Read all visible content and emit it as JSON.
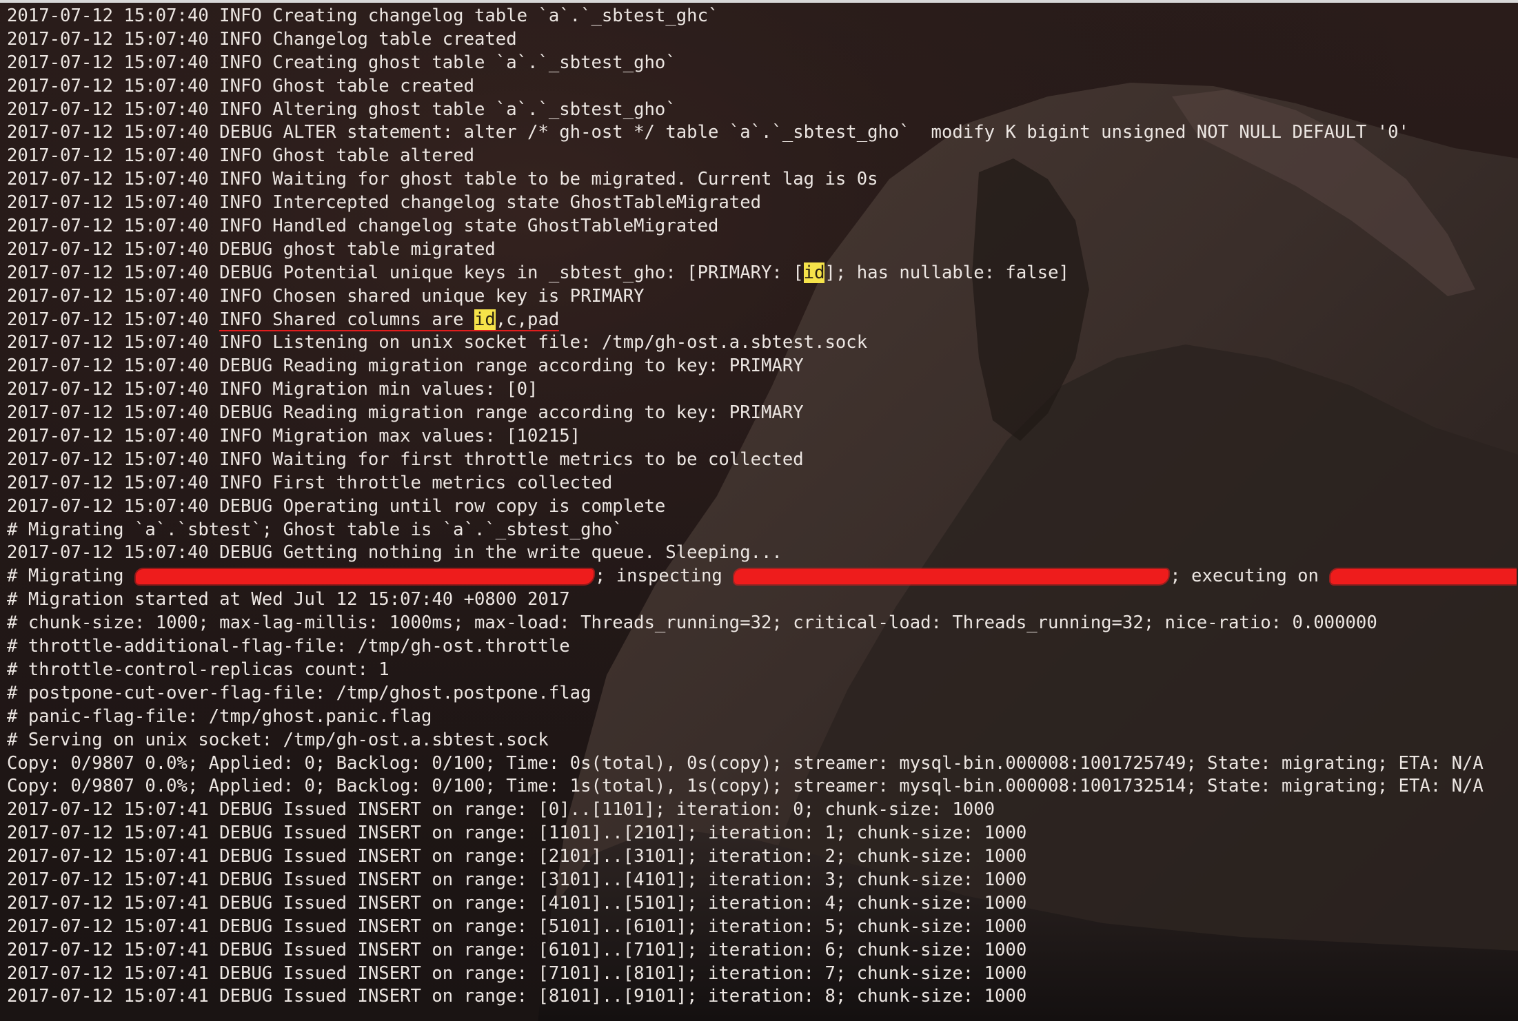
{
  "terminal": {
    "lines": [
      {
        "segments": [
          {
            "text": "2017-07-12 15:07:40 INFO Creating changelog table `a`.`_sbtest_ghc`"
          }
        ]
      },
      {
        "segments": [
          {
            "text": "2017-07-12 15:07:40 INFO Changelog table created"
          }
        ]
      },
      {
        "segments": [
          {
            "text": "2017-07-12 15:07:40 INFO Creating ghost table `a`.`_sbtest_gho`"
          }
        ]
      },
      {
        "segments": [
          {
            "text": "2017-07-12 15:07:40 INFO Ghost table created"
          }
        ]
      },
      {
        "segments": [
          {
            "text": "2017-07-12 15:07:40 INFO Altering ghost table `a`.`_sbtest_gho`"
          }
        ]
      },
      {
        "segments": [
          {
            "text": "2017-07-12 15:07:40 DEBUG ALTER statement: alter /* gh-ost */ table `a`.`_sbtest_gho`  modify K bigint unsigned NOT NULL DEFAULT '0'"
          }
        ]
      },
      {
        "segments": [
          {
            "text": "2017-07-12 15:07:40 INFO Ghost table altered"
          }
        ]
      },
      {
        "segments": [
          {
            "text": "2017-07-12 15:07:40 INFO Waiting for ghost table to be migrated. Current lag is 0s"
          }
        ]
      },
      {
        "segments": [
          {
            "text": "2017-07-12 15:07:40 INFO Intercepted changelog state GhostTableMigrated"
          }
        ]
      },
      {
        "segments": [
          {
            "text": "2017-07-12 15:07:40 INFO Handled changelog state GhostTableMigrated"
          }
        ]
      },
      {
        "segments": [
          {
            "text": "2017-07-12 15:07:40 DEBUG ghost table migrated"
          }
        ]
      },
      {
        "segments": [
          {
            "text": "2017-07-12 15:07:40 DEBUG Potential unique keys in _sbtest_gho: [PRIMARY: ["
          },
          {
            "text": "id",
            "style": "hl"
          },
          {
            "text": "]; has nullable: false]"
          }
        ]
      },
      {
        "segments": [
          {
            "text": "2017-07-12 15:07:40 INFO Chosen shared unique key is PRIMARY"
          }
        ]
      },
      {
        "segments": [
          {
            "text": "2017-07-12 15:07:40 "
          },
          {
            "text": "INFO Shared columns are ",
            "style": "underlined"
          },
          {
            "text": "id",
            "style": "hl underlined"
          },
          {
            "text": ",c,pad",
            "style": "underlined"
          }
        ]
      },
      {
        "segments": [
          {
            "text": "2017-07-12 15:07:40 INFO Listening on unix socket file: /tmp/gh-ost.a.sbtest.sock"
          }
        ]
      },
      {
        "segments": [
          {
            "text": "2017-07-12 15:07:40 DEBUG Reading migration range according to key: PRIMARY"
          }
        ]
      },
      {
        "segments": [
          {
            "text": "2017-07-12 15:07:40 INFO Migration min values: [0]"
          }
        ]
      },
      {
        "segments": [
          {
            "text": "2017-07-12 15:07:40 DEBUG Reading migration range according to key: PRIMARY"
          }
        ]
      },
      {
        "segments": [
          {
            "text": "2017-07-12 15:07:40 INFO Migration max values: [10215]"
          }
        ]
      },
      {
        "segments": [
          {
            "text": "2017-07-12 15:07:40 INFO Waiting for first throttle metrics to be collected"
          }
        ]
      },
      {
        "segments": [
          {
            "text": "2017-07-12 15:07:40 INFO First throttle metrics collected"
          }
        ]
      },
      {
        "segments": [
          {
            "text": "2017-07-12 15:07:40 DEBUG Operating until row copy is complete"
          }
        ]
      },
      {
        "segments": [
          {
            "text": "# Migrating `a`.`sbtest`; Ghost table is `a`.`_sbtest_gho`"
          }
        ]
      },
      {
        "segments": [
          {
            "text": "2017-07-12 15:07:40 DEBUG Getting nothing in the write queue. Sleeping..."
          }
        ]
      },
      {
        "segments": [
          {
            "text": "# Migrating "
          },
          {
            "redact": "r1"
          },
          {
            "text": "; inspecting "
          },
          {
            "redact": "r2"
          },
          {
            "text": "; executing on "
          },
          {
            "redact": "r3"
          }
        ]
      },
      {
        "segments": [
          {
            "text": "# Migration started at Wed Jul 12 15:07:40 +0800 2017"
          }
        ]
      },
      {
        "segments": [
          {
            "text": "# chunk-size: 1000; max-lag-millis: 1000ms; max-load: Threads_running=32; critical-load: Threads_running=32; nice-ratio: 0.000000"
          }
        ]
      },
      {
        "segments": [
          {
            "text": "# throttle-additional-flag-file: /tmp/gh-ost.throttle"
          }
        ]
      },
      {
        "segments": [
          {
            "text": "# throttle-control-replicas count: 1"
          }
        ]
      },
      {
        "segments": [
          {
            "text": "# postpone-cut-over-flag-file: /tmp/ghost.postpone.flag"
          }
        ]
      },
      {
        "segments": [
          {
            "text": "# panic-flag-file: /tmp/ghost.panic.flag"
          }
        ]
      },
      {
        "segments": [
          {
            "text": "# Serving on unix socket: /tmp/gh-ost.a.sbtest.sock"
          }
        ]
      },
      {
        "segments": [
          {
            "text": "Copy: 0/9807 0.0%; Applied: 0; Backlog: 0/100; Time: 0s(total), 0s(copy); streamer: mysql-bin.000008:1001725749; State: migrating; ETA: N/A"
          }
        ]
      },
      {
        "segments": [
          {
            "text": "Copy: 0/9807 0.0%; Applied: 0; Backlog: 0/100; Time: 1s(total), 1s(copy); streamer: mysql-bin.000008:1001732514; State: migrating; ETA: N/A"
          }
        ]
      },
      {
        "segments": [
          {
            "text": "2017-07-12 15:07:41 DEBUG Issued INSERT on range: [0]..[1101]; iteration: 0; chunk-size: 1000"
          }
        ]
      },
      {
        "segments": [
          {
            "text": "2017-07-12 15:07:41 DEBUG Issued INSERT on range: [1101]..[2101]; iteration: 1; chunk-size: 1000"
          }
        ]
      },
      {
        "segments": [
          {
            "text": "2017-07-12 15:07:41 DEBUG Issued INSERT on range: [2101]..[3101]; iteration: 2; chunk-size: 1000"
          }
        ]
      },
      {
        "segments": [
          {
            "text": "2017-07-12 15:07:41 DEBUG Issued INSERT on range: [3101]..[4101]; iteration: 3; chunk-size: 1000"
          }
        ]
      },
      {
        "segments": [
          {
            "text": "2017-07-12 15:07:41 DEBUG Issued INSERT on range: [4101]..[5101]; iteration: 4; chunk-size: 1000"
          }
        ]
      },
      {
        "segments": [
          {
            "text": "2017-07-12 15:07:41 DEBUG Issued INSERT on range: [5101]..[6101]; iteration: 5; chunk-size: 1000"
          }
        ]
      },
      {
        "segments": [
          {
            "text": "2017-07-12 15:07:41 DEBUG Issued INSERT on range: [6101]..[7101]; iteration: 6; chunk-size: 1000"
          }
        ]
      },
      {
        "segments": [
          {
            "text": "2017-07-12 15:07:41 DEBUG Issued INSERT on range: [7101]..[8101]; iteration: 7; chunk-size: 1000"
          }
        ]
      },
      {
        "segments": [
          {
            "text": "2017-07-12 15:07:41 DEBUG Issued INSERT on range: [8101]..[9101]; iteration: 8; chunk-size: 1000"
          }
        ]
      }
    ]
  },
  "colors": {
    "text": "#ece6e2",
    "highlight": "#f6e34a",
    "annotation_red": "#e21d1d"
  }
}
